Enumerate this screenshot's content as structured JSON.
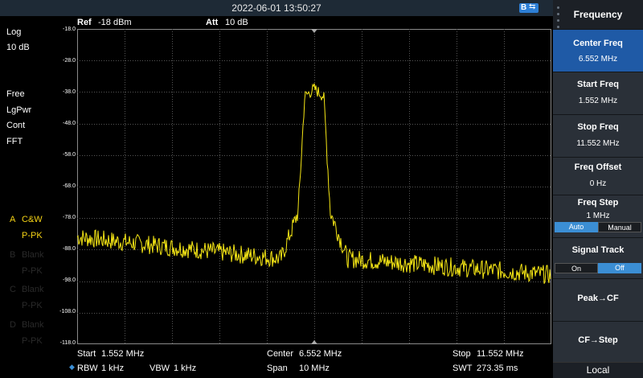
{
  "topbar": {
    "datetime": "2022-06-01 13:50:27",
    "usb_icon": "usb-icon"
  },
  "left_info": {
    "scale_type": "Log",
    "scale_div": "10 dB",
    "mode": [
      "Free",
      "LgPwr",
      "Cont",
      "FFT"
    ],
    "traces": [
      {
        "letter": "A",
        "name": "C&W",
        "detector": "P-PK",
        "active": true
      },
      {
        "letter": "B",
        "name": "Blank",
        "detector": "P-PK",
        "active": false
      },
      {
        "letter": "C",
        "name": "Blank",
        "detector": "P-PK",
        "active": false
      },
      {
        "letter": "D",
        "name": "Blank",
        "detector": "P-PK",
        "active": false
      }
    ]
  },
  "header": {
    "ref_label": "Ref",
    "ref_value": "-18 dBm",
    "att_label": "Att",
    "att_value": "10 dB"
  },
  "plot": {
    "y_ticks": [
      "-18.0",
      "-28.0",
      "-38.0",
      "-48.0",
      "-58.0",
      "-68.0",
      "-78.0",
      "-88.0",
      "-98.0",
      "-108.0",
      "-118.0"
    ],
    "trace_color": "#f5e615"
  },
  "footer": {
    "start_label": "Start",
    "start_value": "1.552 MHz",
    "center_label": "Center",
    "center_value": "6.552 MHz",
    "stop_label": "Stop",
    "stop_value": "11.552 MHz",
    "rbw_label": "RBW",
    "rbw_value": "1 kHz",
    "vbw_label": "VBW",
    "vbw_value": "1 kHz",
    "span_label": "Span",
    "span_value": "10 MHz",
    "swt_label": "SWT",
    "swt_value": "273.35 ms"
  },
  "panel": {
    "title": "Frequency",
    "center_freq": {
      "label": "Center Freq",
      "value": "6.552 MHz"
    },
    "start_freq": {
      "label": "Start Freq",
      "value": "1.552 MHz"
    },
    "stop_freq": {
      "label": "Stop Freq",
      "value": "11.552 MHz"
    },
    "freq_offset": {
      "label": "Freq Offset",
      "value": "0 Hz"
    },
    "freq_step": {
      "label": "Freq Step",
      "value": "1 MHz",
      "opt_auto": "Auto",
      "opt_manual": "Manual"
    },
    "signal_track": {
      "label": "Signal Track",
      "opt_on": "On",
      "opt_off": "Off"
    },
    "peak_cf": {
      "label": "Peak→CF"
    },
    "cf_step": {
      "label": "CF→Step"
    },
    "local": "Local"
  }
}
